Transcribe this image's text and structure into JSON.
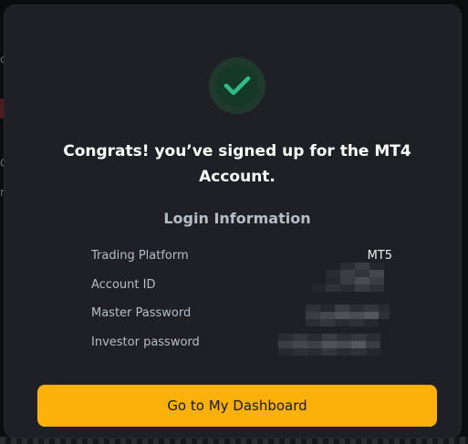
{
  "modal": {
    "title": "Congrats! you’ve signed up for the MT4 Account.",
    "section_title": "Login Information",
    "rows": [
      {
        "label": "Trading Platform",
        "value": "MT5"
      },
      {
        "label": "Account ID",
        "value": ""
      },
      {
        "label": "Master Password",
        "value": ""
      },
      {
        "label": "Investor password",
        "value": ""
      }
    ],
    "cta_label": "Go to My Dashboard"
  },
  "colors": {
    "accent": "#FCB00A",
    "success": "#2EBD85",
    "modal_bg": "#1E2026",
    "page_bg": "#0B0C0E"
  },
  "icons": {
    "status": "check-circle-icon"
  }
}
